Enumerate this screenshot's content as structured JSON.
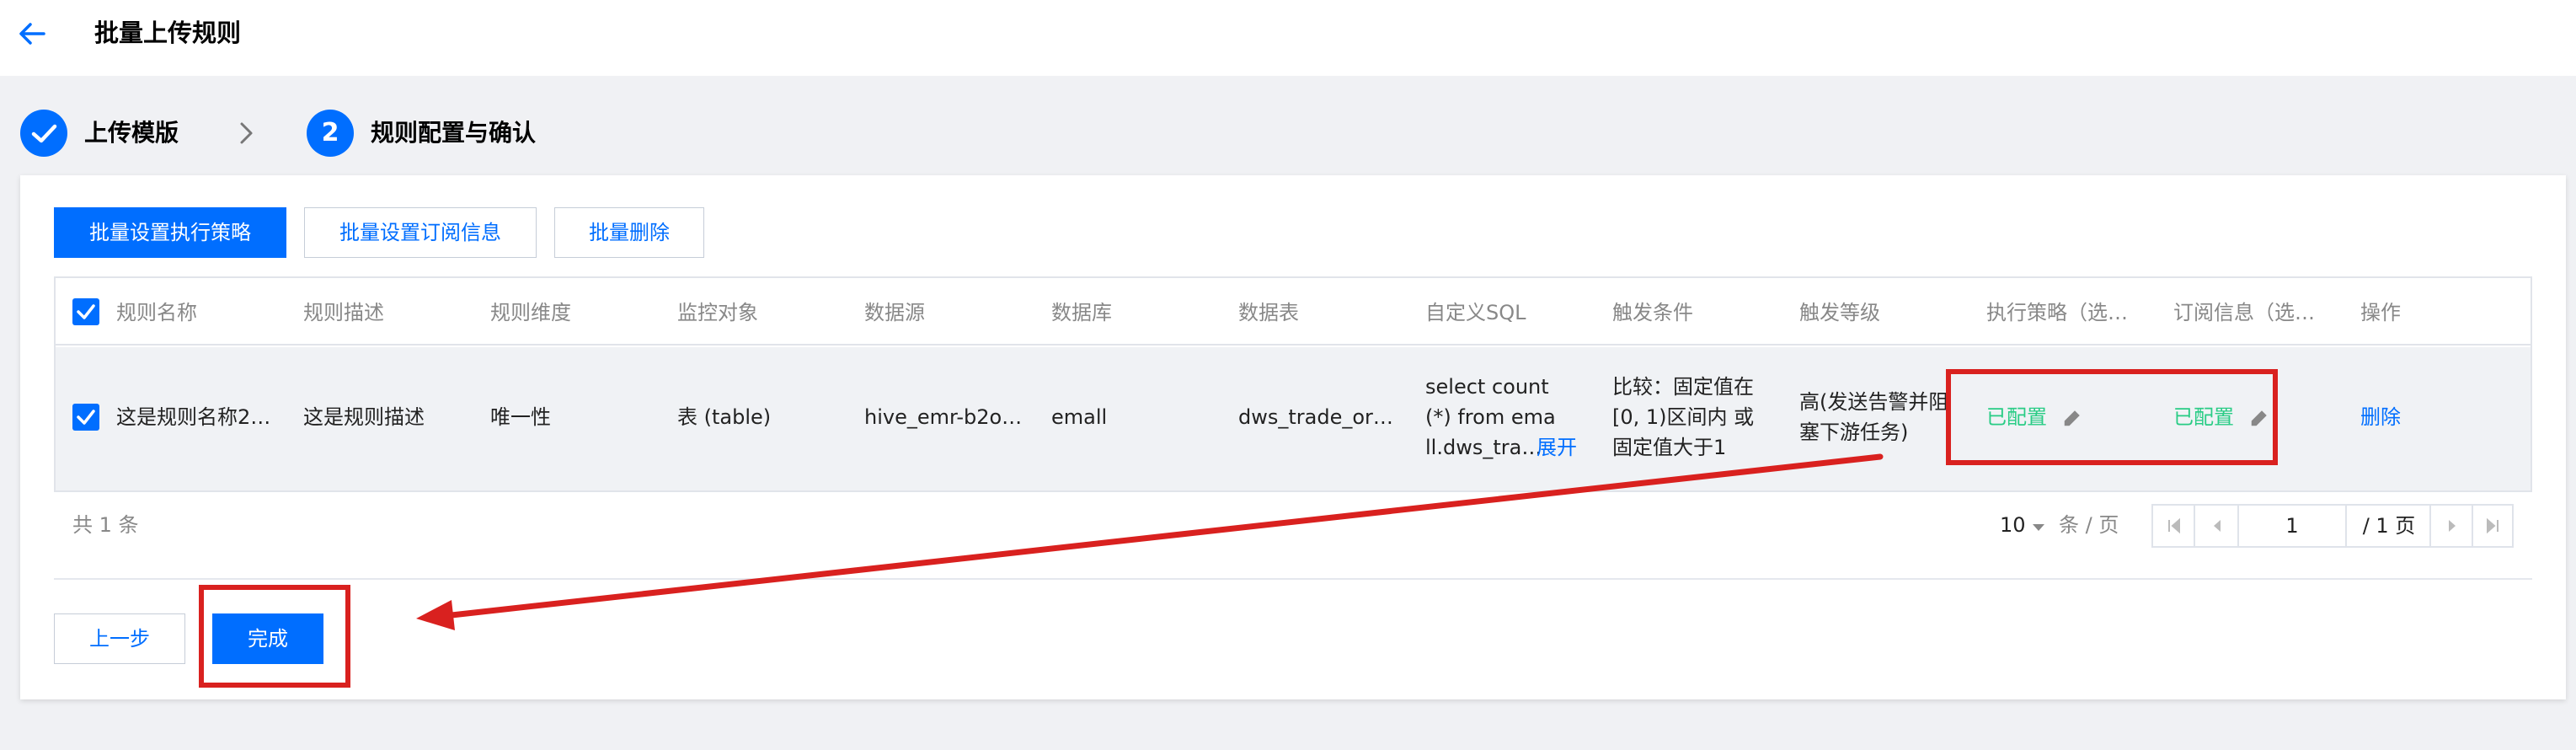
{
  "header": {
    "title": "批量上传规则"
  },
  "steps": [
    {
      "label": "上传模版",
      "state": "done"
    },
    {
      "label": "规则配置与确认",
      "number": "2",
      "state": "active"
    }
  ],
  "toolbar": {
    "batch_strategy": "批量设置执行策略",
    "batch_subscribe": "批量设置订阅信息",
    "batch_delete": "批量删除"
  },
  "table": {
    "columns": [
      "规则名称",
      "规则描述",
      "规则维度",
      "监控对象",
      "数据源",
      "数据库",
      "数据表",
      "自定义SQL",
      "触发条件",
      "触发等级",
      "执行策略（选…",
      "订阅信息（选…",
      "操作"
    ],
    "rows": [
      {
        "name": "这是规则名称2…",
        "desc": "这是规则描述",
        "dimension": "唯一性",
        "target": "表 (table)",
        "source": "hive_emr-b2o…",
        "database": "emall",
        "table": "dws_trade_or…",
        "sql_line1": "select count",
        "sql_line2": "(*) from ema",
        "sql_line3": "ll.dws_tra…",
        "sql_expand": "展开",
        "cond_line1": "比较：固定值在",
        "cond_line2": "[0, 1)区间内 或",
        "cond_line3": "固定值大于1",
        "level_line1": "高(发送告警并阻",
        "level_line2": "塞下游任务)",
        "strategy": "已配置",
        "subscribe": "已配置",
        "action": "删除"
      }
    ]
  },
  "pagination": {
    "total": "共 1 条",
    "page_size": "10",
    "per_page_unit": "条 / 页",
    "current_page": "1",
    "total_pages": "/ 1 页"
  },
  "footer": {
    "prev": "上一步",
    "finish": "完成"
  },
  "colors": {
    "primary": "#006eff",
    "success": "#29cc85",
    "annotation": "#d9211f"
  }
}
